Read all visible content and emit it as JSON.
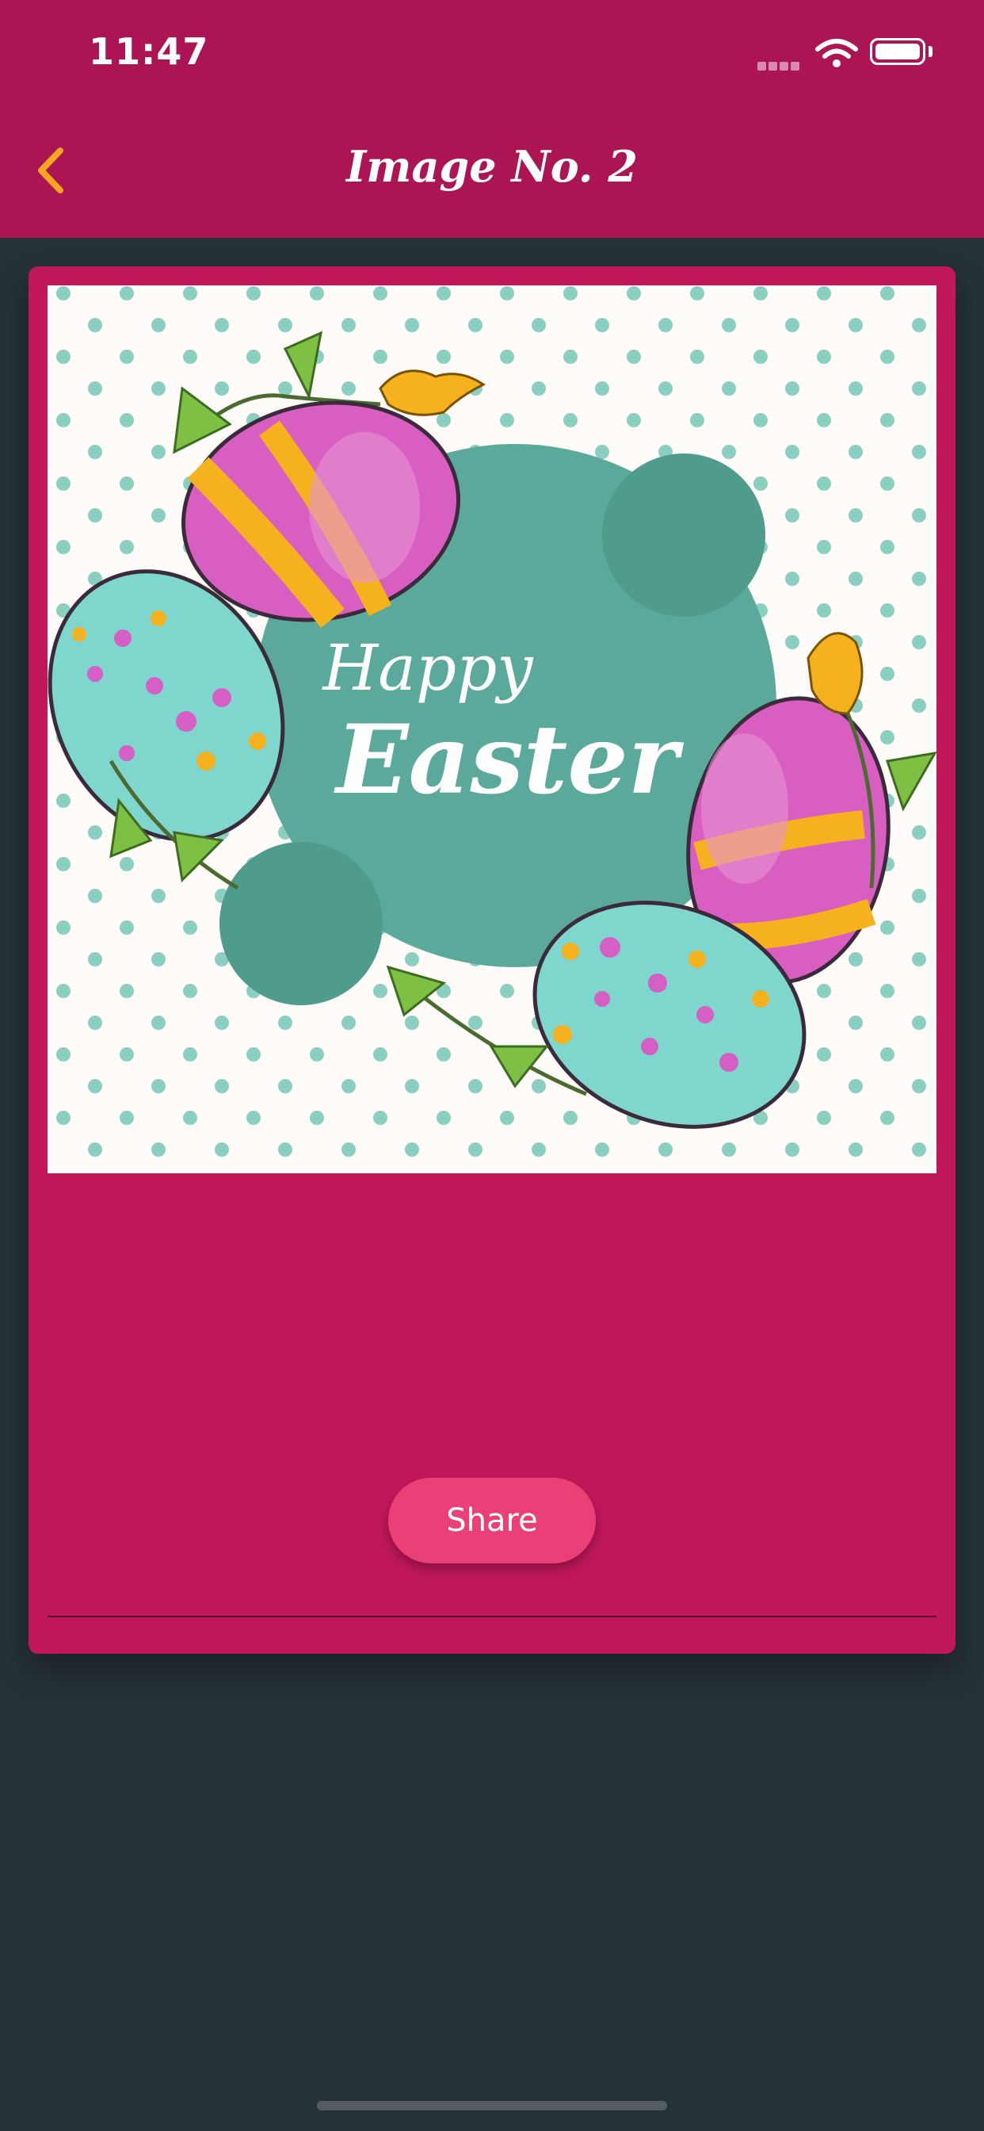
{
  "status_bar": {
    "time": "11:47"
  },
  "header": {
    "title": "Image No. 2",
    "back_icon": "chevron-left-icon"
  },
  "card": {
    "image": {
      "text_line1": "Happy",
      "text_line2": "Easter"
    },
    "share_label": "Share"
  },
  "colors": {
    "header": "#AC1553",
    "card": "#C1185A",
    "share_button": "#EA3F77",
    "background": "#263238",
    "back_chevron": "#F5A623",
    "teal_circle": "#5BA99A"
  }
}
